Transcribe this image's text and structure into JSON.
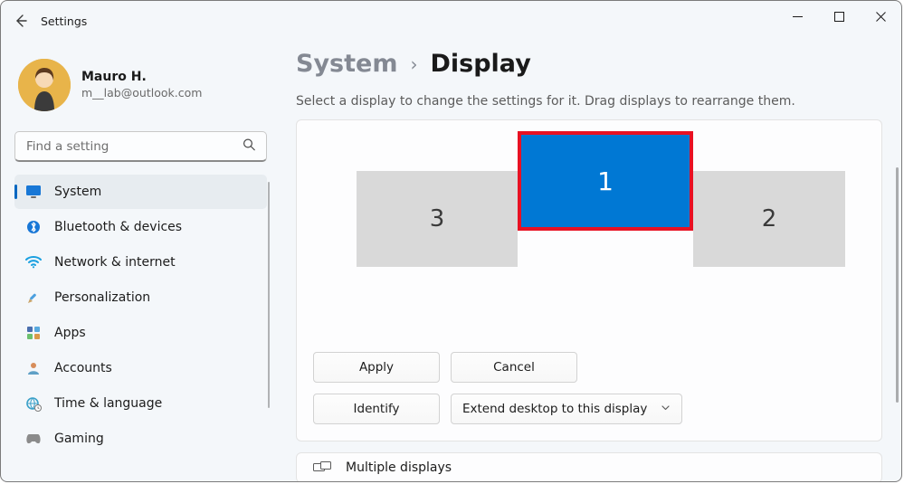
{
  "window": {
    "app_title": "Settings"
  },
  "profile": {
    "name": "Mauro H.",
    "email": "m__lab@outlook.com"
  },
  "search": {
    "placeholder": "Find a setting"
  },
  "nav": {
    "items": [
      {
        "key": "system",
        "label": "System",
        "selected": true
      },
      {
        "key": "bluetooth",
        "label": "Bluetooth & devices",
        "selected": false
      },
      {
        "key": "network",
        "label": "Network & internet",
        "selected": false
      },
      {
        "key": "personalization",
        "label": "Personalization",
        "selected": false
      },
      {
        "key": "apps",
        "label": "Apps",
        "selected": false
      },
      {
        "key": "accounts",
        "label": "Accounts",
        "selected": false
      },
      {
        "key": "time",
        "label": "Time & language",
        "selected": false
      },
      {
        "key": "gaming",
        "label": "Gaming",
        "selected": false
      }
    ]
  },
  "breadcrumb": {
    "parent": "System",
    "current": "Display"
  },
  "subtext": "Select a display to change the settings for it. Drag displays to rearrange them.",
  "displays": {
    "d1": "1",
    "d2": "2",
    "d3": "3"
  },
  "buttons": {
    "apply": "Apply",
    "cancel": "Cancel",
    "identify": "Identify",
    "extend": "Extend desktop to this display"
  },
  "next_card": {
    "title": "Multiple displays"
  }
}
